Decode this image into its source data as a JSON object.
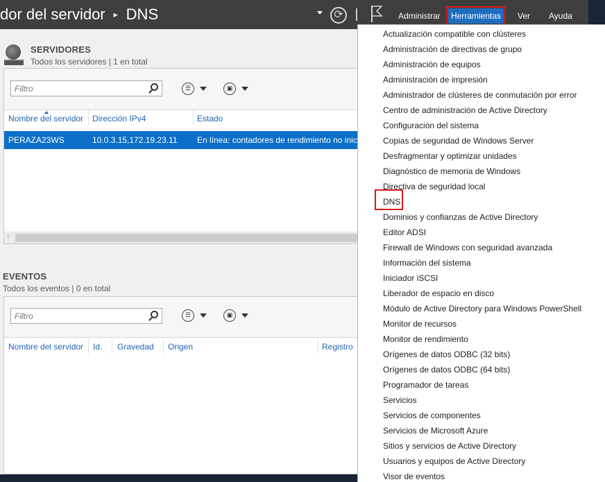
{
  "titlebar": {
    "breadcrumb_prefix": "dor del servidor",
    "breadcrumb_separator": "▸",
    "breadcrumb_current": "DNS",
    "refresh_glyph": "⟳",
    "menu": {
      "manage": "Administrar",
      "tools": "Herramientas",
      "view": "Ver",
      "help": "Ayuda"
    }
  },
  "servers": {
    "title": "SERVIDORES",
    "subtitle": "Todos los servidores | 1 en total",
    "filter_placeholder": "Filtro",
    "columns": [
      "Nombre del servidor",
      "Dirección IPv4",
      "Estado"
    ],
    "rows": [
      {
        "name": "PERAZA23WS",
        "ipv4": "10.0.3.15,172.19.23.11",
        "status": "En línea: contadores de rendimiento no inic"
      }
    ],
    "scroll_left_glyph": "‹"
  },
  "events": {
    "title": "EVENTOS",
    "subtitle": "Todos los eventos | 0 en total",
    "filter_placeholder": "Filtro",
    "columns": [
      "Nombre del servidor",
      "Id.",
      "Gravedad",
      "Origen",
      "Registro"
    ]
  },
  "tools_menu": {
    "items": [
      "Actualización compatible con clústeres",
      "Administración de directivas de grupo",
      "Administración de equipos",
      "Administración de impresión",
      "Administrador de clústeres de conmutación por error",
      "Centro de administración de Active Directory",
      "Configuración del sistema",
      "Copias de seguridad de Windows Server",
      "Desfragmentar y optimizar unidades",
      "Diagnóstico de memoria de Windows",
      "Directiva de seguridad local",
      "DNS",
      "Dominios y confianzas de Active Directory",
      "Editor ADSI",
      "Firewall de Windows con seguridad avanzada",
      "Información del sistema",
      "Iniciador iSCSI",
      "Liberador de espacio en disco",
      "Módulo de Active Directory para Windows PowerShell",
      "Monitor de recursos",
      "Monitor de rendimiento",
      "Orígenes de datos ODBC (32 bits)",
      "Orígenes de datos ODBC (64 bits)",
      "Programador de tareas",
      "Servicios",
      "Servicios de componentes",
      "Servicios de Microsoft Azure",
      "Sitios y servicios de Active Directory",
      "Usuarios y equipos de Active Directory",
      "Visor de eventos"
    ],
    "highlighted": "DNS"
  },
  "colors": {
    "titlebar_bg": "#3e3e3e",
    "active_menu_bg": "#1f6ec0",
    "highlight_outline": "#d81a1a",
    "selected_row_bg": "#0c70c8",
    "column_header_text": "#1f64b4"
  }
}
